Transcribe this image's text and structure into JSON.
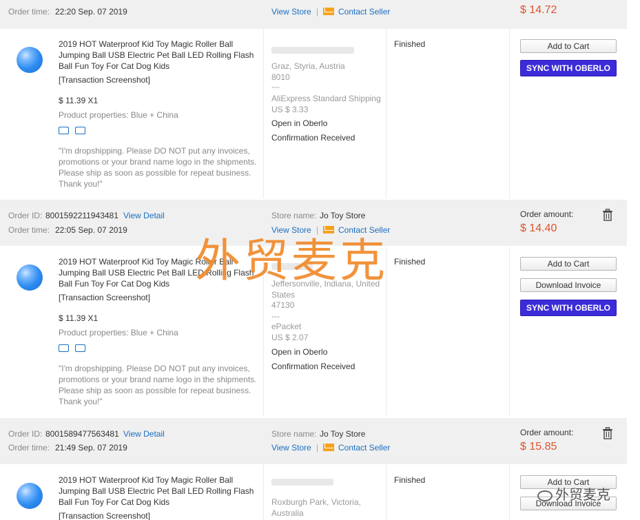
{
  "orders": [
    {
      "order_id_label": "",
      "order_id": "",
      "view_detail": "",
      "order_time_label": "Order time:",
      "order_time": "22:20 Sep. 07 2019",
      "store_label": "",
      "store_name": "",
      "view_store": "View Store",
      "contact_seller": "Contact Seller",
      "amount_label": "",
      "amount": "$ 14.72",
      "product": {
        "title": "2019 HOT Waterproof Kid Toy Magic Roller Ball Jumping Ball USB Electric Pet Ball LED Rolling Flash Ball Fun Toy For Cat Dog Kids",
        "screenshot_link": "[Transaction Screenshot]",
        "price_qty": "$ 11.39 X1",
        "properties": "Product properties: Blue + China",
        "note": "\"I'm dropshipping. Please DO NOT put any invoices, promotions or your brand name logo in the shipments. Please ship as soon as possible for repeat business. Thank you!\""
      },
      "shipping": {
        "address_line": "Graz, Styria, Austria",
        "postcode": "8010",
        "divider": "---",
        "method": "AliExpress Standard Shipping",
        "cost": "US $ 3.33",
        "open_oberlo": "Open in Oberlo",
        "confirmation": "Confirmation Received"
      },
      "status": "Finished",
      "buttons": [
        "Add to Cart",
        "SYNC WITH OBERLO"
      ]
    },
    {
      "order_id_label": "Order ID:",
      "order_id": "8001592211943481",
      "view_detail": "View Detail",
      "order_time_label": "Order time:",
      "order_time": "22:05 Sep. 07 2019",
      "store_label": "Store name:",
      "store_name": "Jo Toy Store",
      "view_store": "View Store",
      "contact_seller": "Contact Seller",
      "amount_label": "Order amount:",
      "amount": "$ 14.40",
      "product": {
        "title": "2019 HOT Waterproof Kid Toy Magic Roller Ball Jumping Ball USB Electric Pet Ball LED Rolling Flash Ball Fun Toy For Cat Dog Kids",
        "screenshot_link": "[Transaction Screenshot]",
        "price_qty": "$ 11.39 X1",
        "properties": "Product properties: Blue + China",
        "note": "\"I'm dropshipping. Please DO NOT put any invoices, promotions or your brand name logo in the shipments. Please ship as soon as possible for repeat business. Thank you!\""
      },
      "shipping": {
        "address_line": "Jeffersonville, Indiana, United States",
        "postcode": "47130",
        "divider": "---",
        "method": "ePacket",
        "cost": "US $ 2.07",
        "open_oberlo": "Open in Oberlo",
        "confirmation": "Confirmation Received"
      },
      "status": "Finished",
      "buttons": [
        "Add to Cart",
        "Download Invoice",
        "SYNC WITH OBERLO"
      ]
    },
    {
      "order_id_label": "Order ID:",
      "order_id": "8001589477563481",
      "view_detail": "View Detail",
      "order_time_label": "Order time:",
      "order_time": "21:49 Sep. 07 2019",
      "store_label": "Store name:",
      "store_name": "Jo Toy Store",
      "view_store": "View Store",
      "contact_seller": "Contact Seller",
      "amount_label": "Order amount:",
      "amount": "$ 15.85",
      "product": {
        "title": "2019 HOT Waterproof Kid Toy Magic Roller Ball Jumping Ball USB Electric Pet Ball LED Rolling Flash Ball Fun Toy For Cat Dog Kids",
        "screenshot_link": "[Transaction Screenshot]"
      },
      "shipping": {
        "address_line": "Roxburgh Park, Victoria,",
        "country": "Australia"
      },
      "status": "Finished",
      "buttons": [
        "Add to Cart",
        "Download Invoice"
      ]
    }
  ],
  "watermark": "外贸麦克",
  "corner_watermark": "外贸麦克",
  "colors": {
    "accent": "#1a6ec0",
    "price": "#e0522c",
    "oberlo": "#3c2bd8",
    "watermark": "#f08a2c"
  }
}
